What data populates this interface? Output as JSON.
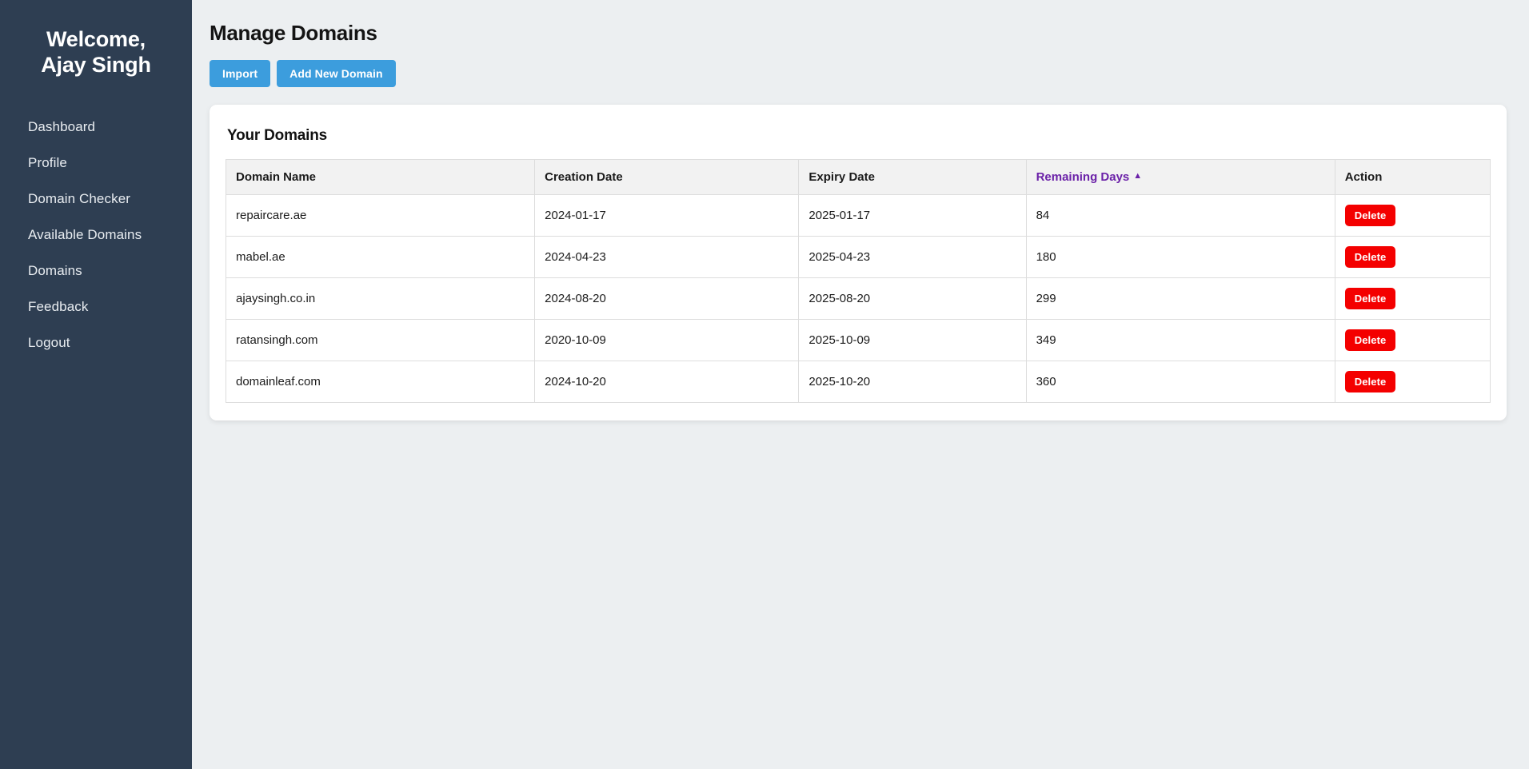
{
  "sidebar": {
    "welcome_line1": "Welcome,",
    "welcome_line2": "Ajay Singh",
    "items": [
      {
        "label": "Dashboard"
      },
      {
        "label": "Profile"
      },
      {
        "label": "Domain Checker"
      },
      {
        "label": "Available Domains"
      },
      {
        "label": "Domains"
      },
      {
        "label": "Feedback"
      },
      {
        "label": "Logout"
      }
    ]
  },
  "main": {
    "page_title": "Manage Domains",
    "toolbar": {
      "import_label": "Import",
      "add_new_domain_label": "Add New Domain"
    },
    "card": {
      "title": "Your Domains",
      "table": {
        "columns": [
          {
            "label": "Domain Name",
            "sorted": false
          },
          {
            "label": "Creation Date",
            "sorted": false
          },
          {
            "label": "Expiry Date",
            "sorted": false
          },
          {
            "label": "Remaining Days",
            "sorted": true,
            "sort_arrow": "▲"
          },
          {
            "label": "Action",
            "sorted": false
          }
        ],
        "rows": [
          {
            "domain_name": "repaircare.ae",
            "creation_date": "2024-01-17",
            "expiry_date": "2025-01-17",
            "remaining_days": "84",
            "action_label": "Delete"
          },
          {
            "domain_name": "mabel.ae",
            "creation_date": "2024-04-23",
            "expiry_date": "2025-04-23",
            "remaining_days": "180",
            "action_label": "Delete"
          },
          {
            "domain_name": "ajaysingh.co.in",
            "creation_date": "2024-08-20",
            "expiry_date": "2025-08-20",
            "remaining_days": "299",
            "action_label": "Delete"
          },
          {
            "domain_name": "ratansingh.com",
            "creation_date": "2020-10-09",
            "expiry_date": "2025-10-09",
            "remaining_days": "349",
            "action_label": "Delete"
          },
          {
            "domain_name": "domainleaf.com",
            "creation_date": "2024-10-20",
            "expiry_date": "2025-10-20",
            "remaining_days": "360",
            "action_label": "Delete"
          }
        ]
      }
    }
  },
  "colors": {
    "sidebar_bg": "#2e3e52",
    "page_bg": "#eceff1",
    "primary_button": "#3c9ddd",
    "delete_button": "#f40000",
    "sort_header": "#6b21a8",
    "card_bg": "#ffffff",
    "table_header_bg": "#f2f2f2"
  }
}
